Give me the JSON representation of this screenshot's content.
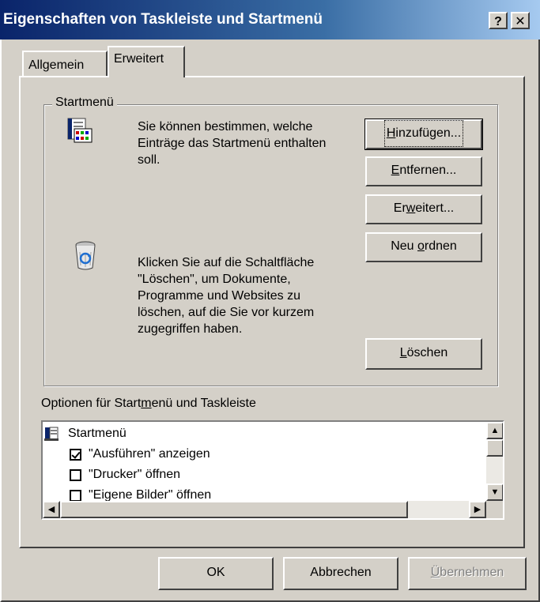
{
  "window": {
    "title": "Eigenschaften von Taskleiste und Startmenü",
    "help_button": "?",
    "close_button": "✕"
  },
  "tabs": [
    {
      "label": "Allgemein",
      "active": false
    },
    {
      "label": "Erweitert",
      "active": true
    }
  ],
  "startmenu_group": {
    "label": "Startmenü",
    "customize_text": "Sie können bestimmen, welche Einträge das Startmenü enthalten soll.",
    "clear_text": "Klicken Sie auf die Schaltfläche \"Löschen\", um Dokumente, Programme und Websites zu löschen, auf die Sie vor kurzem zugegriffen haben.",
    "buttons": {
      "add": {
        "pre": "",
        "acc": "H",
        "post": "inzufügen..."
      },
      "remove": {
        "pre": "",
        "acc": "E",
        "post": "ntfernen..."
      },
      "advanced": {
        "pre": "Er",
        "acc": "w",
        "post": "eitert..."
      },
      "resort": {
        "pre": "Neu ",
        "acc": "o",
        "post": "rdnen"
      },
      "clear": {
        "pre": "",
        "acc": "L",
        "post": "öschen"
      }
    }
  },
  "options": {
    "label_pre": "Optionen für Start",
    "label_acc": "m",
    "label_post": "enü und Taskleiste",
    "root": "Startmenü",
    "items": [
      {
        "label": "\"Ausführen\" anzeigen",
        "checked": true
      },
      {
        "label": "\"Drucker\" öffnen",
        "checked": false
      },
      {
        "label": "\"Eigene Bilder\" öffnen",
        "checked": false
      }
    ]
  },
  "footer": {
    "ok": "OK",
    "cancel": "Abbrechen",
    "apply_acc": "Ü",
    "apply_post": "bernehmen"
  },
  "colors": {
    "title_start": "#0a246a",
    "title_end": "#a6caf0",
    "face": "#d4d0c8"
  }
}
